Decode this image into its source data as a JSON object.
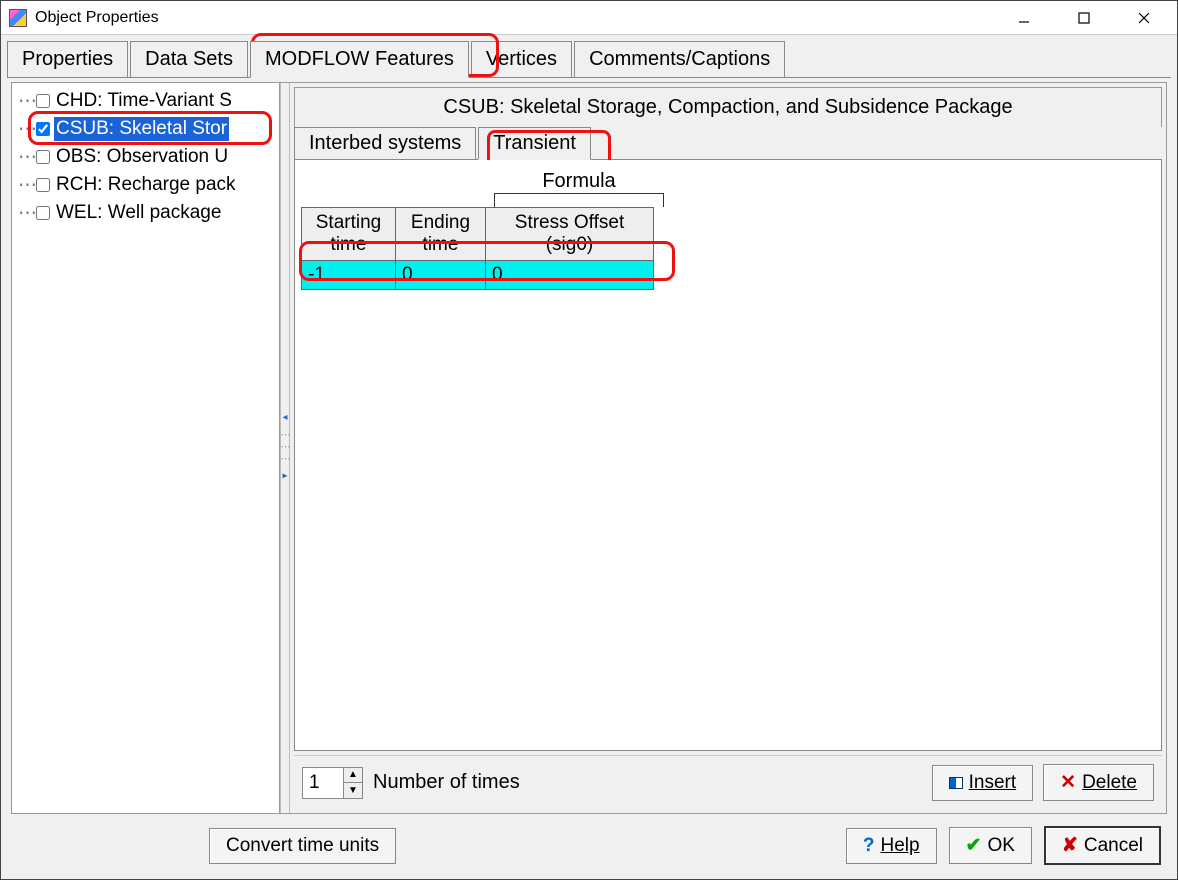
{
  "window": {
    "title": "Object Properties"
  },
  "tabs": {
    "items": [
      "Properties",
      "Data Sets",
      "MODFLOW Features",
      "Vertices",
      "Comments/Captions"
    ],
    "active_index": 2
  },
  "tree": {
    "items": [
      {
        "label": "CHD: Time-Variant S",
        "checked": false,
        "selected": false
      },
      {
        "label": "CSUB: Skeletal Stor",
        "checked": true,
        "selected": true
      },
      {
        "label": "OBS: Observation U",
        "checked": false,
        "selected": false
      },
      {
        "label": "RCH: Recharge pack",
        "checked": false,
        "selected": false
      },
      {
        "label": "WEL: Well package",
        "checked": false,
        "selected": false
      }
    ]
  },
  "panel": {
    "title": "CSUB: Skeletal Storage, Compaction, and Subsidence Package",
    "inner_tabs": {
      "items": [
        "Interbed systems",
        "Transient"
      ],
      "active_index": 1
    },
    "formula_label": "Formula",
    "grid": {
      "headers": [
        "Starting time",
        "Ending time",
        "Stress Offset (sig0)"
      ],
      "rows": [
        [
          "-1",
          "0",
          "0"
        ]
      ]
    },
    "times": {
      "value": "1",
      "label": "Number of times"
    },
    "buttons": {
      "insert": "Insert",
      "delete": "Delete"
    }
  },
  "footer": {
    "convert": "Convert time units",
    "help": "Help",
    "ok": "OK",
    "cancel": "Cancel"
  }
}
